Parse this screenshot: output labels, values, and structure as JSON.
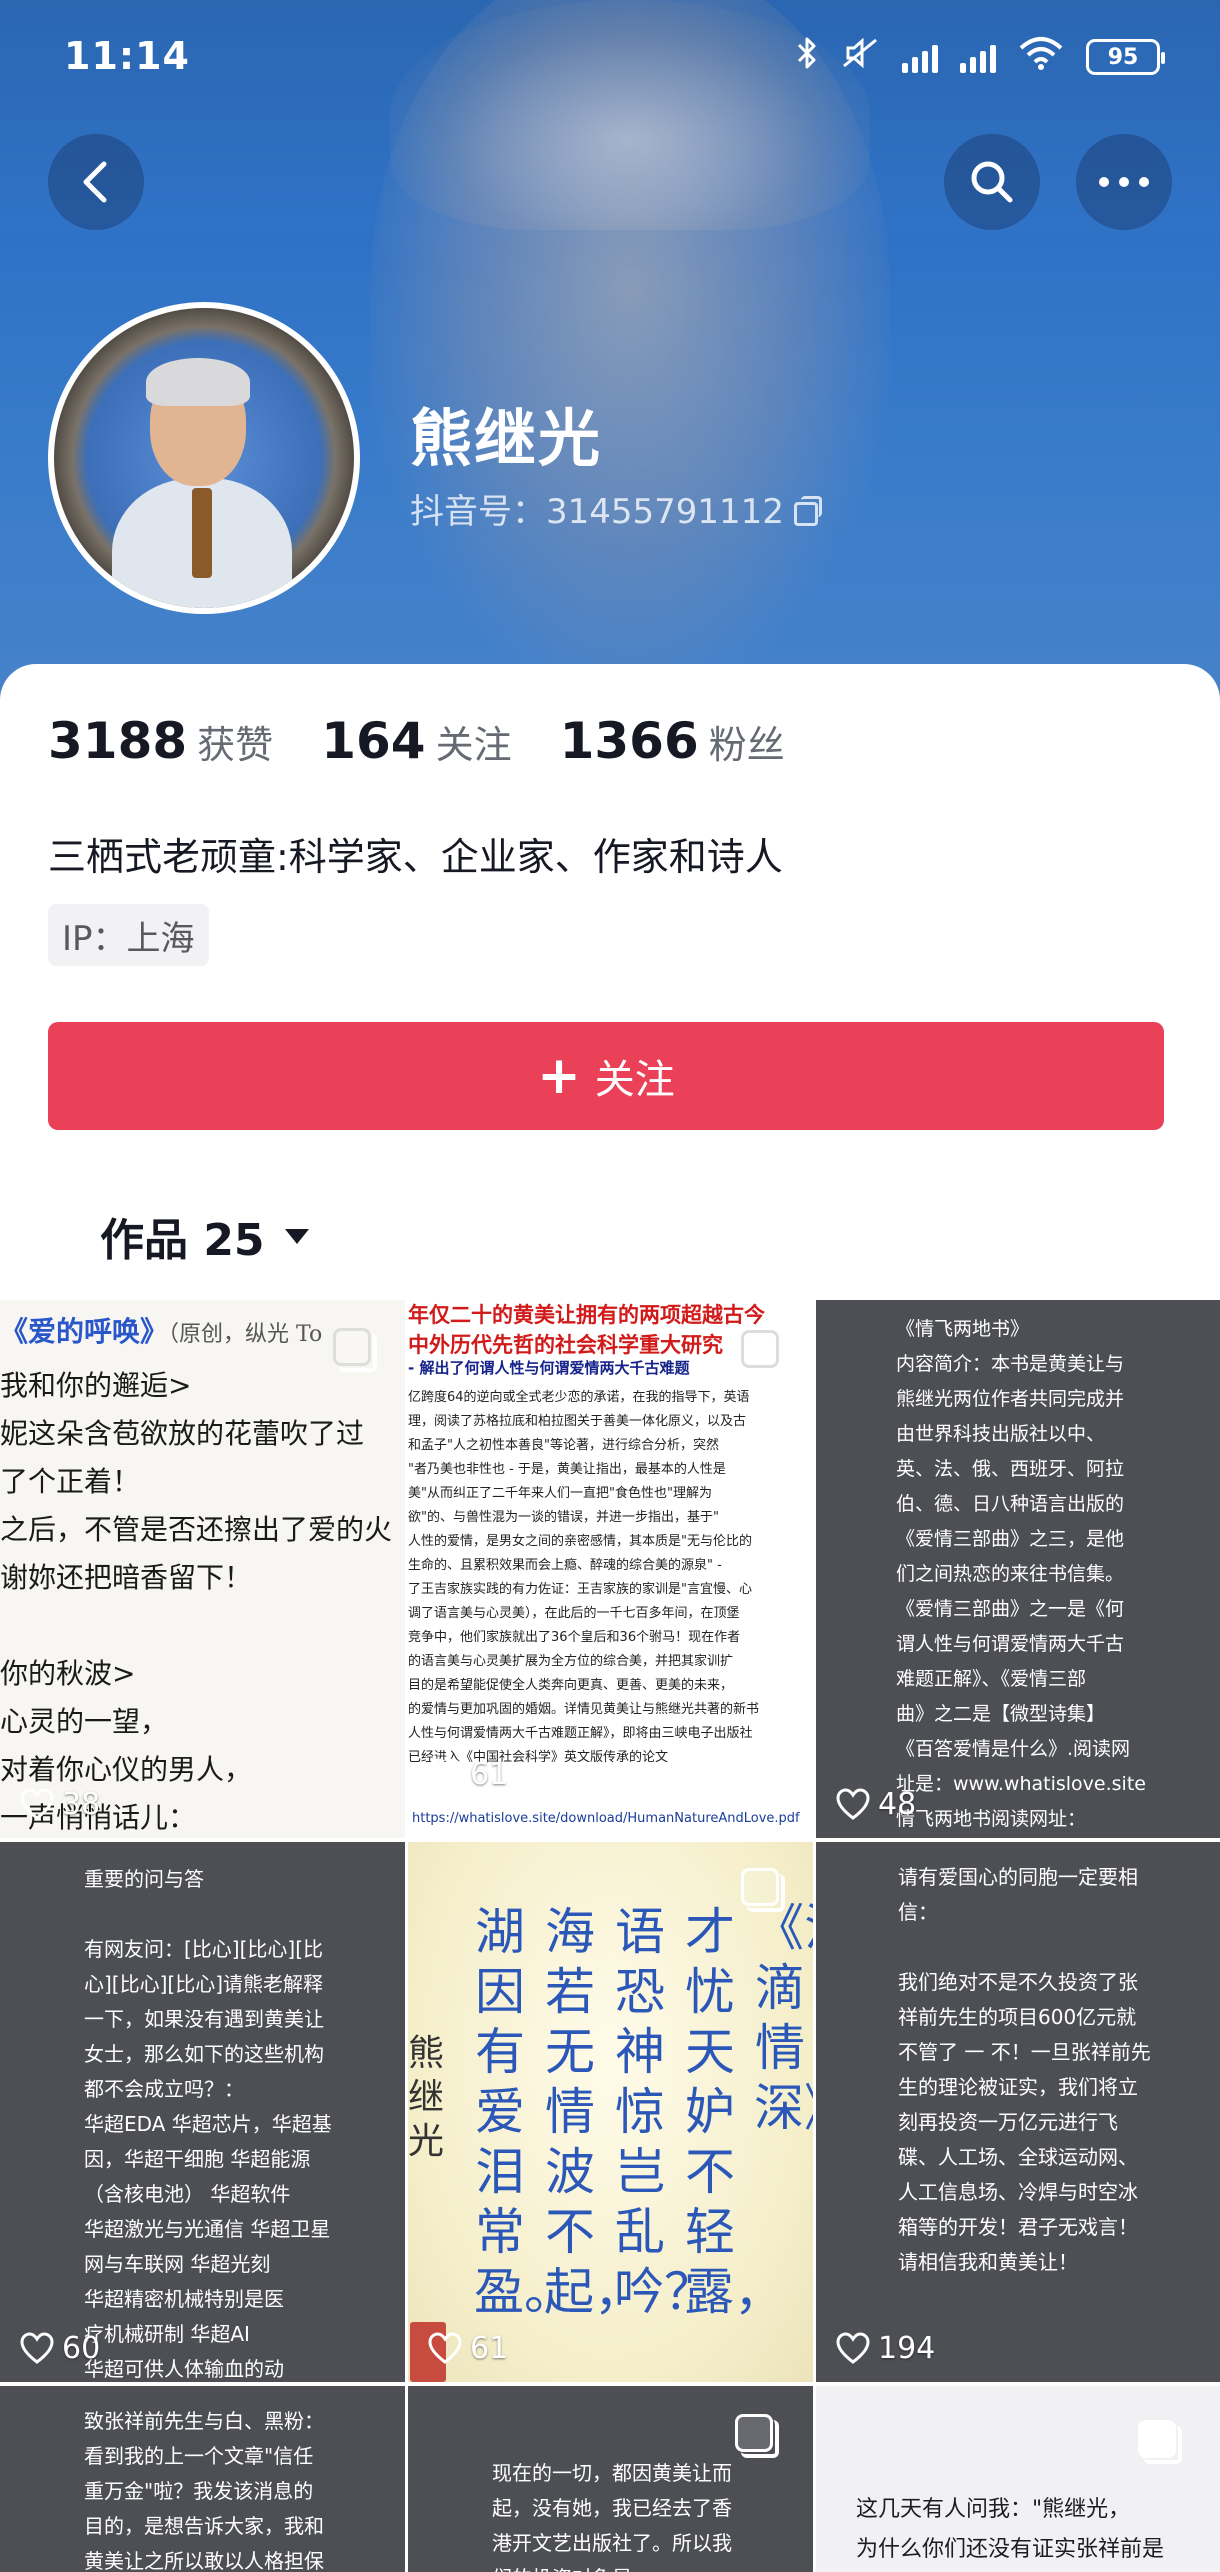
{
  "status_bar": {
    "time": "11:14",
    "battery": "95"
  },
  "profile": {
    "name": "熊继光",
    "id_text": "抖音号：31455791112",
    "stats": [
      {
        "value": "3188",
        "label": "获赞"
      },
      {
        "value": "164",
        "label": "关注"
      },
      {
        "value": "1366",
        "label": "粉丝"
      }
    ],
    "bio": "三栖式老顽童:科学家、企业家、作家和诗人",
    "ip": "IP：上海",
    "follow_label": "关注"
  },
  "tabs": {
    "works_label": "作品 25"
  },
  "colors": {
    "accent": "#ea4158",
    "banner": "#2f72c6",
    "tile_dark": "#4d4f55"
  },
  "grid": {
    "tile1": {
      "title": "《爱的呼唤》",
      "title_note": "（原创，纵光 To",
      "text": "我和你的邂逅>\n妮这朵含苞欲放的花蕾吹了过\n了个正着！\n之后，不管是否还擦出了爱的火\n谢妳还把暗香留下！\n\n你的秋波>\n心灵的一望，\n对着你心仪的男人，\n一声悄悄话儿：\n吧，我喜欢你！”",
      "likes": "38"
    },
    "tile2": {
      "headline": "年仅二十的黄美让拥有的两项超越古今\n中外历代先哲的社会科学重大研究",
      "sub": "- 解出了何谓人性与何谓爱情两大千古难题",
      "body": "亿跨度64的逆向或全式老少恋的承诺，在我的指导下，英语\n理，阅读了苏格拉底和柏拉图关于善美一体化原义，以及古\n和孟子\"人之初性本善良\"等论著，进行综合分析，突然\n\"者乃美也非性也 - 于是，黄美让指出，最基本的人性是\n美\"从而纠正了二千年来人们一直把\"食色性也\"理解为\n欲\"的、与兽性混为一谈的错误，并进一步指出，基于\"\n人性的爱情，是男女之间的亲密感情，其本质是\"无与伦比的\n生命的、且累积效果而会上瘾、醉魂的综合美的源泉\" -\n了王吉家族实践的有力佐证：王吉家族的家训是\"言宜慢、心\n调了语言美与心灵美），在此后的一千七百多年间，在顶堡\n竞争中，他们家族就出了36个皇后和36个驸马！现在作者\n的语言美与心灵美扩展为全方位的综合美，并把其家训扩\n目的是希望能促使全人类奔向更真、更善、更美的未来，\n的爱情与更加巩固的婚姻。详情见黄美让与熊继光共著的新书\n人性与何谓爱情两大千古难题正解》，即将由三峡电子出版社\n已经进入《中国社会科学》英文版传承的论文",
      "link": "https://whatislove.site/download/HumanNatureAndLove.pdf",
      "likes": "61"
    },
    "tile3": {
      "text": "《情飞两地书》\n内容简介：本书是黄美让与\n熊继光两位作者共同完成并\n由世界科技出版社以中、\n英、法、俄、西班牙、阿拉\n伯、德、日八种语言出版的\n《爱情三部曲》之三，是他\n们之间热恋的来往书信集。\n《爱情三部曲》之一是《何\n谓人性与何谓爱情两大千古\n难题正解》、《爱情三部\n曲》之二是【微型诗集】\n《百答爱情是什么》.阅读网\n址是：www.whatislove.site\n情飞两地书阅读网址：\nhttps://whatislove.site/do",
      "likes": "48"
    },
    "tile4": {
      "text": "重要的问与答\n\n有网友问：[比心][比心][比\n心][比心][比心]请熊老解释\n一下，如果没有遇到黄美让\n女士，那么如下的这些机构\n都不会成立吗？：\n华超EDA 华超芯片，华超基\n因，华超干细胞 华超能源\n（含核电池） 华超软件\n华超激光与光通信 华超卫星\n网与车联网 华超光刻\n华超精密机械特别是医\n疗机械研制 华超AI\n华超可供人体输血的动\n物血液研究与应用开发",
      "likes": "60"
    },
    "tile5": {
      "columns": [
        "《泪滴情深》",
        "才忧天妒不轻露，",
        "语恐神惊岂乱吟？",
        "海若无情波不起，",
        "湖因有爱泪常盈。",
        "熊继光"
      ],
      "likes": "61"
    },
    "tile6": {
      "text": "请有爱国心的同胞一定要相\n信：\n\n我们绝对不是不久投资了张\n祥前先生的项目600亿元就\n不管了 一 不！一旦张祥前先\n生的理论被证实，我们将立\n刻再投资一万亿元进行飞\n碟、人工场、全球运动网、\n人工信息场、冷焊与时空冰\n箱等的开发！君子无戏言！\n请相信我和黄美让！",
      "likes": "194"
    },
    "tile7": {
      "text": "致张祥前先生与白、黑粉：\n看到我的上一个文章\"信任\n重万金\"啦？我发该消息的\n目的，是想告诉大家，我和\n黄美让之所以敢以人格担保"
    },
    "tile8": {
      "text": "现在的一切，都因黄美让而\n起，没有她，我已经去了香\n港开文艺出版社了。所以我\n们的投资对象是..."
    },
    "tile9": {
      "text": "这几天有人问我：\"熊继光，\n为什么你们还没有证实张祥前是"
    }
  }
}
